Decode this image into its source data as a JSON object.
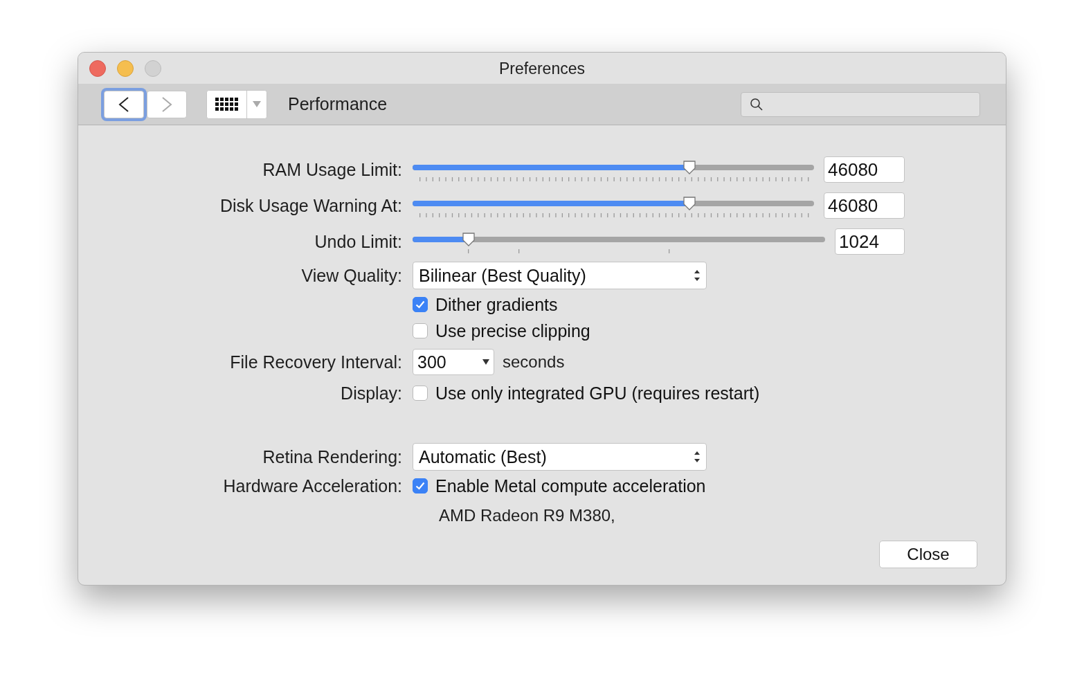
{
  "window": {
    "title": "Preferences"
  },
  "toolbar": {
    "back_enabled": true,
    "forward_enabled": false,
    "pane_title": "Performance"
  },
  "rows": [
    {
      "kind": "ticked_slider",
      "label": "RAM Usage Limit:",
      "level": 0.69,
      "value": "46080"
    },
    {
      "kind": "ticked_slider",
      "label": "Disk Usage Warning At:",
      "level": 0.69,
      "value": "46080"
    },
    {
      "kind": "slider",
      "label": "Undo Limit:",
      "level": 0.136,
      "value": "1024"
    },
    {
      "kind": "popup",
      "label": "View Quality:",
      "value": "Bilinear (Best Quality)"
    },
    {
      "kind": "checkbox",
      "text": "Dither gradients",
      "checked": true
    },
    {
      "kind": "checkbox",
      "text": "Use precise clipping",
      "checked": false
    },
    {
      "kind": "combo",
      "label": "File Recovery Interval:",
      "value": "300",
      "unit": "seconds"
    },
    {
      "kind": "checkbox",
      "label": "Display:",
      "text": "Use only integrated GPU (requires restart)",
      "checked": false
    },
    {
      "kind": "spacer"
    },
    {
      "kind": "popup",
      "label": "Retina Rendering:",
      "value": "Automatic (Best)"
    },
    {
      "kind": "checkbox",
      "label": "Hardware Acceleration:",
      "text": "Enable Metal compute acceleration",
      "checked": true
    },
    {
      "kind": "note",
      "text": "AMD Radeon R9 M380,"
    }
  ],
  "buttons": [
    "Close"
  ]
}
